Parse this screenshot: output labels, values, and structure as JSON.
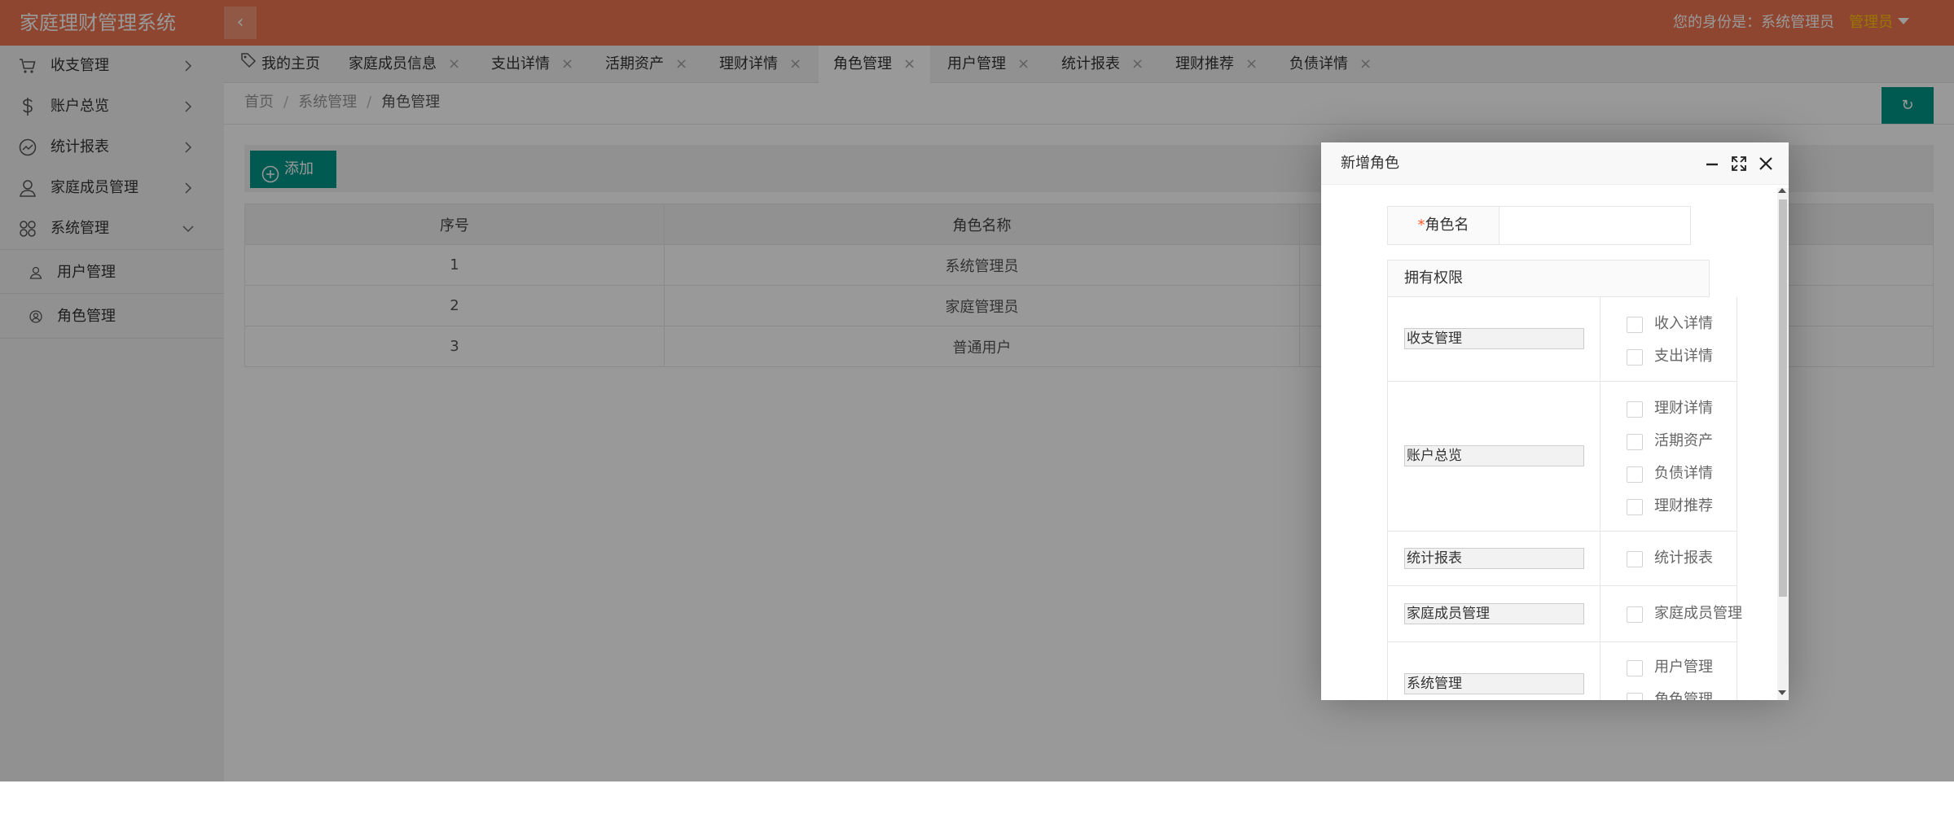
{
  "header": {
    "app_title": "家庭理财管理系统",
    "collapse_glyph": "‹",
    "identity_text": "您的身份是：系统管理员",
    "user_role": "管理员"
  },
  "sidebar": {
    "items": [
      {
        "label": "收支管理",
        "icon": "cart-icon"
      },
      {
        "label": "账户总览",
        "icon": "dollar-icon"
      },
      {
        "label": "统计报表",
        "icon": "chart-icon"
      },
      {
        "label": "家庭成员管理",
        "icon": "user-icon"
      },
      {
        "label": "系统管理",
        "icon": "apps-icon"
      }
    ],
    "subitems": [
      {
        "label": "用户管理",
        "icon": "user-icon"
      },
      {
        "label": "角色管理",
        "icon": "user-circle-icon"
      }
    ]
  },
  "tabs": [
    {
      "label": "我的主页"
    },
    {
      "label": "家庭成员信息"
    },
    {
      "label": "支出详情"
    },
    {
      "label": "活期资产"
    },
    {
      "label": "理财详情"
    },
    {
      "label": "角色管理"
    },
    {
      "label": "用户管理"
    },
    {
      "label": "统计报表"
    },
    {
      "label": "理财推荐"
    },
    {
      "label": "负债详情"
    }
  ],
  "tab_close_glyph": "×",
  "breadcrumb": {
    "home": "首页",
    "parent": "系统管理",
    "current": "角色管理",
    "separator": "/"
  },
  "refresh_glyph": "↻",
  "toolbar": {
    "add_label": "添加"
  },
  "table": {
    "columns": [
      "序号",
      "角色名称",
      ""
    ],
    "rows": [
      [
        "1",
        "系统管理员"
      ],
      [
        "2",
        "家庭管理员"
      ],
      [
        "3",
        "普通用户"
      ]
    ]
  },
  "modal": {
    "title": "新增角色",
    "required_mark": "*",
    "role_name_label": "角色名",
    "role_name_value": "",
    "permissions_header": "拥有权限",
    "groups": [
      {
        "name": "收支管理",
        "options": [
          "收入详情",
          "支出详情"
        ]
      },
      {
        "name": "账户总览",
        "options": [
          "理财详情",
          "活期资产",
          "负债详情",
          "理财推荐"
        ]
      },
      {
        "name": "统计报表",
        "options": [
          "统计报表"
        ]
      },
      {
        "name": "家庭成员管理",
        "options": [
          "家庭成员管理"
        ]
      },
      {
        "name": "系统管理",
        "options": [
          "用户管理",
          "角色管理"
        ]
      }
    ]
  },
  "colors": {
    "header_bg": "#ef7550",
    "accent": "#009688",
    "role_highlight": "#ffc600"
  }
}
